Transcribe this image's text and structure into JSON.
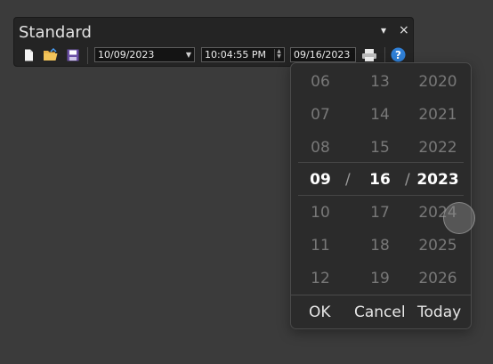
{
  "toolbar": {
    "title": "Standard",
    "menu_glyph": "▾",
    "close_glyph": "×",
    "icons": [
      "new-document-icon",
      "open-folder-icon",
      "save-icon",
      "print-icon",
      "help-icon"
    ],
    "date_combo": "10/09/2023",
    "time_field": "10:04:55 PM",
    "date_field": "09/16/2023"
  },
  "picker": {
    "months": [
      "06",
      "07",
      "08",
      "09",
      "10",
      "11",
      "12"
    ],
    "days": [
      "13",
      "14",
      "15",
      "16",
      "17",
      "18",
      "19"
    ],
    "years": [
      "2020",
      "2021",
      "2022",
      "2023",
      "2024",
      "2025",
      "2026"
    ],
    "separator": "/",
    "ok": "OK",
    "cancel": "Cancel",
    "today": "Today"
  },
  "colors": {
    "background": "#3b3b3b",
    "toolbar": "#242424",
    "picker": "#2b2b2b",
    "help_blue": "#2f7fd6"
  }
}
